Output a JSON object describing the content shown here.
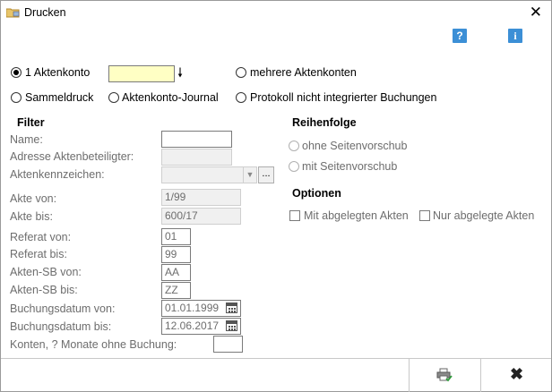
{
  "window": {
    "title": "Drucken"
  },
  "toolbar": {
    "help_label": "?",
    "info_label": "i"
  },
  "scope": {
    "aktenkonto_label": "1 Aktenkonto",
    "aktenkonto_value": "",
    "mehrere_label": "mehrere Aktenkonten",
    "sammeldruck_label": "Sammeldruck",
    "journal_label": "Aktenkonto-Journal",
    "protokoll_label": "Protokoll nicht integrierter Buchungen"
  },
  "filter": {
    "heading": "Filter",
    "name_label": "Name:",
    "name_value": "",
    "adresse_label": "Adresse Aktenbeteiligter:",
    "adresse_value": "",
    "kennzeichen_label": "Aktenkennzeichen:",
    "kennzeichen_value": "",
    "ellipsis_label": "...",
    "akte_von_label": "Akte von:",
    "akte_von_value": "1/99",
    "akte_bis_label": "Akte bis:",
    "akte_bis_value": "600/17",
    "referat_von_label": "Referat von:",
    "referat_von_value": "01",
    "referat_bis_label": "Referat bis:",
    "referat_bis_value": "99",
    "sb_von_label": "Akten-SB von:",
    "sb_von_value": "AA",
    "sb_bis_label": "Akten-SB bis:",
    "sb_bis_value": "ZZ",
    "buchung_von_label": "Buchungsdatum von:",
    "buchung_von_value": "01.01.1999",
    "buchung_bis_label": "Buchungsdatum bis:",
    "buchung_bis_value": "12.06.2017",
    "konten_label": "Konten, ? Monate ohne Buchung:",
    "konten_value": ""
  },
  "reihenfolge": {
    "heading": "Reihenfolge",
    "ohne_label": "ohne Seitenvorschub",
    "mit_label": "mit Seitenvorschub"
  },
  "optionen": {
    "heading": "Optionen",
    "mit_abgelegt_label": "Mit abgelegten Akten",
    "nur_abgelegt_label": "Nur abgelegte Akten"
  }
}
